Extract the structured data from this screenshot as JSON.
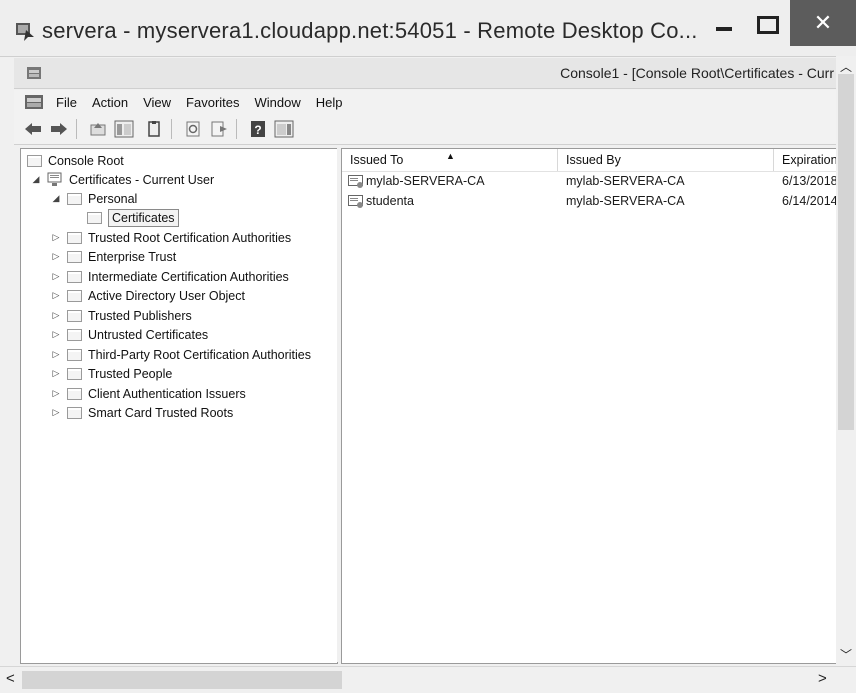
{
  "rdp": {
    "title": "servera - myservera1.cloudapp.net:54051 - Remote Desktop Co...",
    "close_glyph": "✕"
  },
  "mmc": {
    "title": "Console1 - [Console Root\\Certificates - Curr"
  },
  "menu": [
    "File",
    "Action",
    "View",
    "Favorites",
    "Window",
    "Help"
  ],
  "toolbar_icons": [
    "back-icon",
    "forward-icon",
    "up-icon",
    "show-hide-tree-icon",
    "copy-icon",
    "refresh-icon",
    "export-list-icon",
    "help-icon",
    "action-pane-icon"
  ],
  "tree": {
    "root": "Console Root",
    "snapin": "Certificates - Current User",
    "personal": "Personal",
    "selected": "Certificates",
    "folders": [
      "Trusted Root Certification Authorities",
      "Enterprise Trust",
      "Intermediate Certification Authorities",
      "Active Directory User Object",
      "Trusted Publishers",
      "Untrusted Certificates",
      "Third-Party Root Certification Authorities",
      "Trusted People",
      "Client Authentication Issuers",
      "Smart Card Trusted Roots"
    ]
  },
  "list": {
    "columns": [
      "Issued To",
      "Issued By",
      "Expiration"
    ],
    "rows": [
      {
        "issued_to": "mylab-SERVERA-CA",
        "issued_by": "mylab-SERVERA-CA",
        "expiration": "6/13/2018"
      },
      {
        "issued_to": "studenta",
        "issued_by": "mylab-SERVERA-CA",
        "expiration": "6/14/2014"
      }
    ]
  },
  "colors": {
    "close_button": "#5c5c5c",
    "window_bg": "#f0f0f0",
    "pane_bg": "#ffffff"
  }
}
